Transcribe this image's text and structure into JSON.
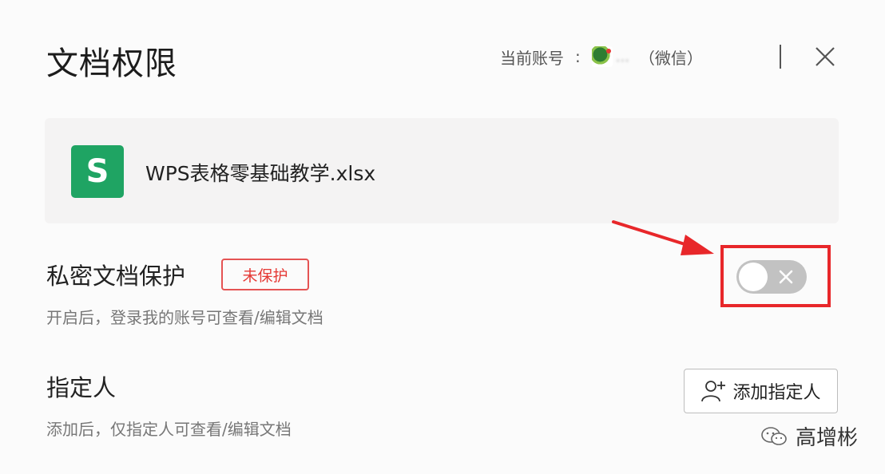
{
  "dialog": {
    "title": "文档权限",
    "account": {
      "label": "当前账号",
      "colon": ":",
      "name": "...",
      "platform": "（微信）"
    }
  },
  "file": {
    "icon_letter": "S",
    "name": "WPS表格零基础教学.xlsx"
  },
  "private_protection": {
    "title": "私密文档保护",
    "badge": "未保护",
    "description": "开启后，登录我的账号可查看/编辑文档",
    "enabled": false
  },
  "designee": {
    "title": "指定人",
    "description": "添加后，仅指定人可查看/编辑文档",
    "add_button_label": "添加指定人"
  },
  "watermark": {
    "text": "高增彬"
  },
  "colors": {
    "accent_red": "#e53935",
    "wps_green": "#1fa463",
    "toggle_off": "#c2c2c2"
  }
}
